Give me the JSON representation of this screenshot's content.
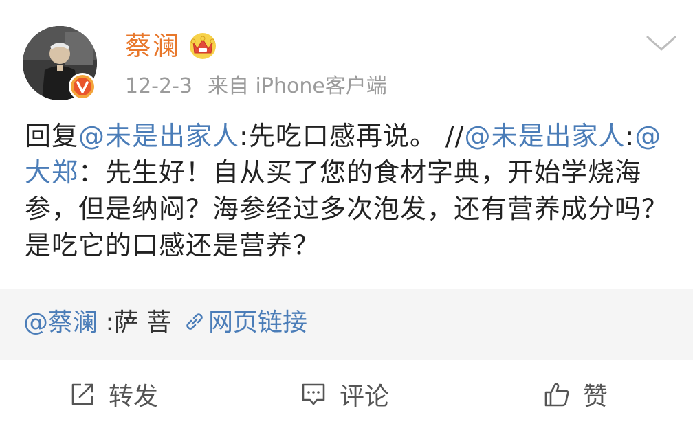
{
  "user": {
    "name": "蔡澜",
    "avatar_icon": "avatar-photo",
    "verified_icon": "verified-v-icon",
    "member_icon": "crown-icon",
    "accent_color": "#e8782c"
  },
  "meta": {
    "date": "12-2-3",
    "source": "来自 iPhone客户端"
  },
  "content": {
    "parts": [
      "回复",
      "@未是出家人",
      ":先吃口感再说。 //",
      "@未是出家人",
      ":",
      "@大郑",
      "：先生好！自从买了您的食材字典，开始学烧海参，但是纳闷？海参经过多次泡发，还有营养成分吗？是吃它的口感还是营养？"
    ],
    "mention_color": "#4b7db8"
  },
  "quote": {
    "mention": "@蔡澜",
    "text": " :萨 菩",
    "link_label": "网页链接"
  },
  "actions": {
    "repost_label": "转发",
    "comment_label": "评论",
    "like_label": "赞"
  }
}
